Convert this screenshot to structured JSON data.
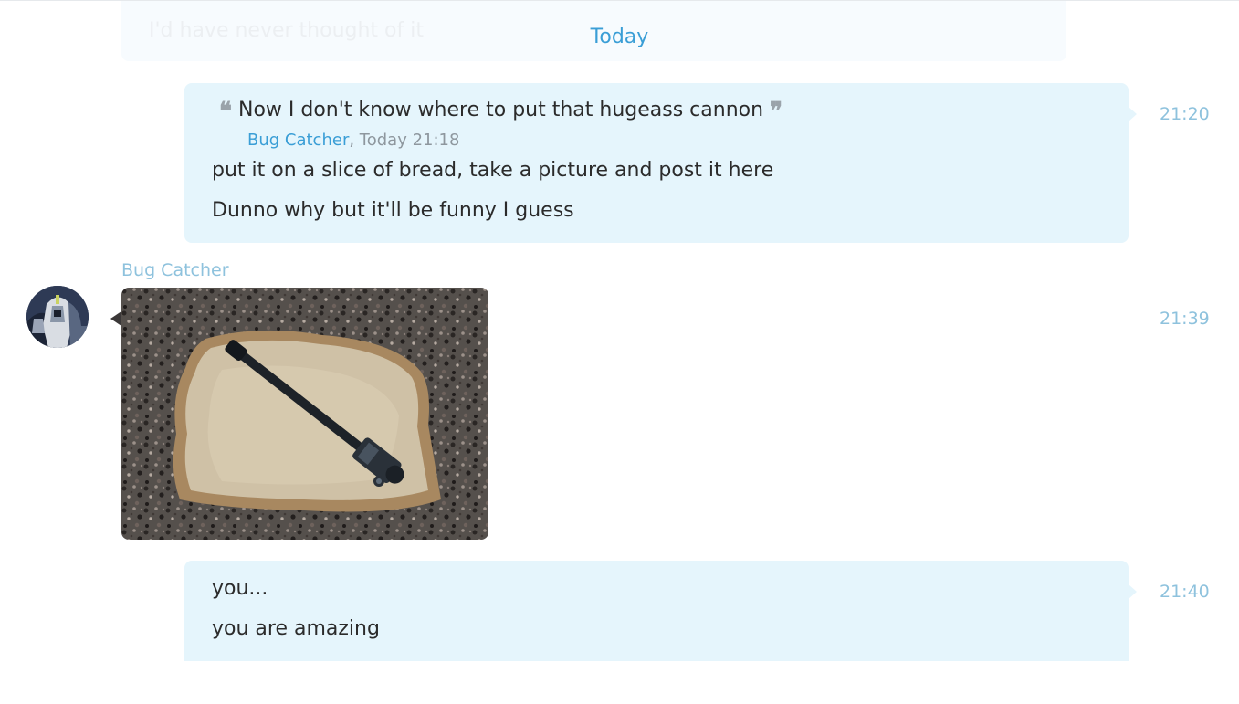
{
  "previous_message": {
    "text": "I'd have never thought of it"
  },
  "date_separator": "Today",
  "messages": [
    {
      "quote": {
        "text": "Now I don't know where to put that hugeass cannon",
        "author": "Bug Catcher",
        "when": ", Today 21:18"
      },
      "lines": [
        "put it on a slice of bread, take a picture and post it here",
        "Dunno why but it'll be funny I guess"
      ],
      "time": "21:20"
    },
    {
      "sender": "Bug Catcher",
      "avatar_icon": "user-avatar",
      "image": "photo of a black toy cannon lying on a slice of bread on a granite counter",
      "time": "21:39"
    },
    {
      "lines": [
        "you...",
        "you are amazing"
      ],
      "time": "21:40"
    }
  ],
  "colors": {
    "bubble": "#e5f5fc",
    "accent": "#3a9ed6",
    "timestamp": "#8ec2dd",
    "text": "#2b2b2b"
  }
}
